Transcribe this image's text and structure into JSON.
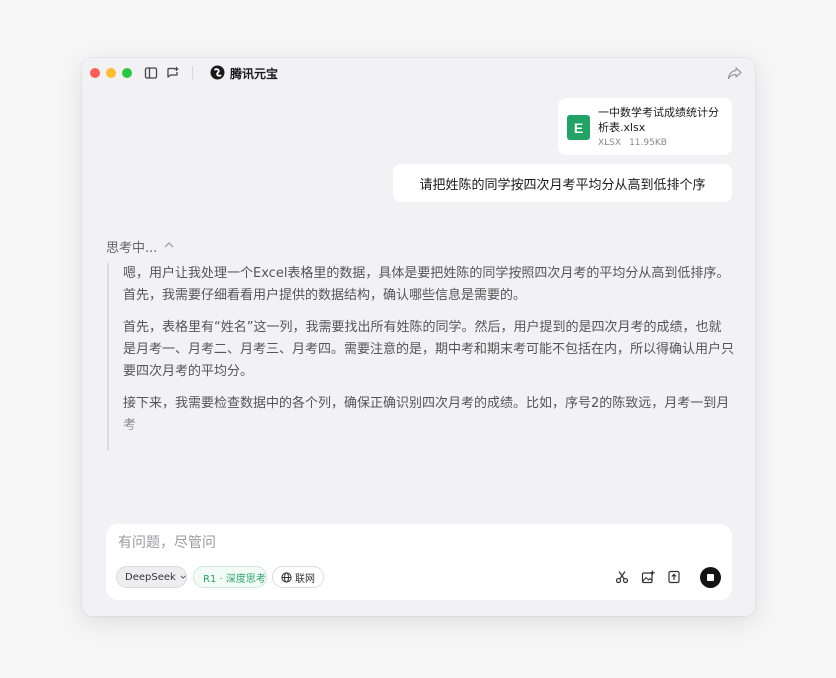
{
  "app": {
    "title": "腾讯元宝"
  },
  "colors": {
    "accent_green": "#2aa36b",
    "excel_green": "#21a366",
    "stop_button": "#141414"
  },
  "attachment": {
    "name": "一中数学考试成绩统计分析表.xlsx",
    "type": "XLSX",
    "size": "11.95KB",
    "icon_letter": "E"
  },
  "user_message": "请把姓陈的同学按四次月考平均分从高到低排个序",
  "thinking": {
    "label": "思考中...",
    "paragraphs": [
      "嗯，用户让我处理一个Excel表格里的数据，具体是要把姓陈的同学按照四次月考的平均分从高到低排序。首先，我需要仔细看看用户提供的数据结构，确认哪些信息是需要的。",
      "首先，表格里有“姓名”这一列，我需要找出所有姓陈的同学。然后，用户提到的是四次月考的成绩，也就是月考一、月考二、月考三、月考四。需要注意的是，期中考和期末考可能不包括在内，所以得确认用户只要四次月考的平均分。",
      "接下来，我需要检查数据中的各个列，确保正确识别四次月考的成绩。比如，序号2的陈致远，月考一到月考"
    ]
  },
  "composer": {
    "placeholder": "有问题，尽管问",
    "model": "DeepSeek",
    "deep_think": "R1 · 深度思考",
    "web": "联网",
    "icons": [
      "scissors-icon",
      "image-add-icon",
      "upload-icon",
      "stop-icon"
    ]
  }
}
